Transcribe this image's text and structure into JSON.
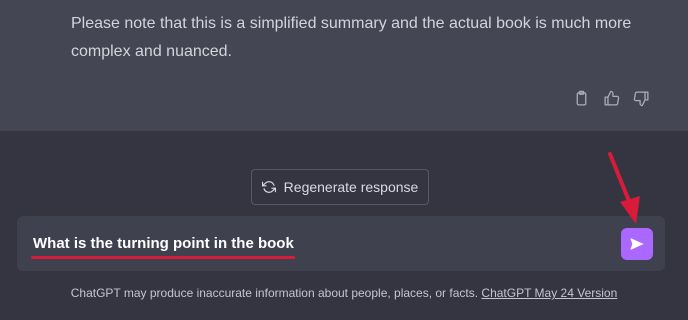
{
  "response": {
    "text": "Please note that this is a simplified summary and the actual book is much more complex and nuanced."
  },
  "actions": {
    "copy_icon": "clipboard-icon",
    "like_icon": "thumbs-up-icon",
    "dislike_icon": "thumbs-down-icon"
  },
  "regenerate": {
    "label": "Regenerate response"
  },
  "composer": {
    "value": "What is the turning point in the book",
    "send_icon": "send-icon"
  },
  "footer": {
    "disclaimer": "ChatGPT may produce inaccurate information about people, places, or facts.",
    "version_link": "ChatGPT May 24 Version"
  },
  "colors": {
    "background": "#343541",
    "response_bg": "#444654",
    "composer_bg": "#40414f",
    "send_button": "#ab68ff",
    "annotation_red": "#d81b3a"
  }
}
